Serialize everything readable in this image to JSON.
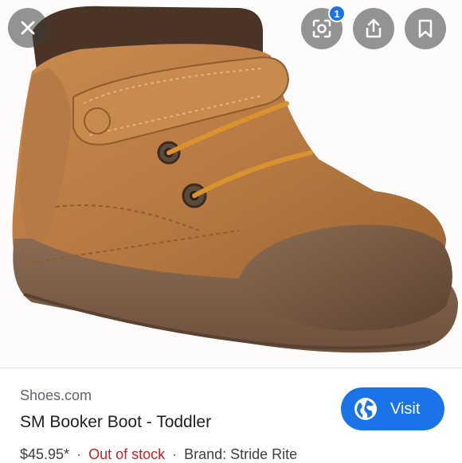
{
  "topbar": {
    "close_icon": "close-icon",
    "lens_icon": "lens-icon",
    "lens_badge": "1",
    "share_icon": "share-icon",
    "save_icon": "bookmark-icon"
  },
  "product": {
    "source": "Shoes.com",
    "title": "SM Booker Boot - Toddler",
    "price": "$45.95*",
    "separator": "·",
    "stock": "Out of stock",
    "brand": "Brand: Stride Rite"
  },
  "visit_button": {
    "label": "Visit",
    "icon": "globe-icon"
  },
  "colors": {
    "accent": "#1a73e8",
    "stock_red": "#c5221f"
  }
}
